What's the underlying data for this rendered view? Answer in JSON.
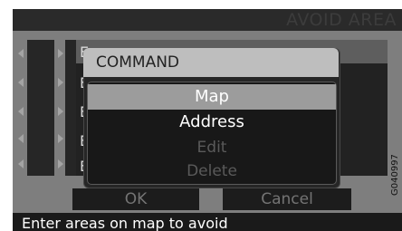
{
  "header": {
    "title": "AVOID AREA"
  },
  "list": {
    "row_initial": "E"
  },
  "dialog": {
    "title": "COMMAND",
    "menu": [
      {
        "label": "Map",
        "state": "selected"
      },
      {
        "label": "Address",
        "state": "enabled"
      },
      {
        "label": "Edit",
        "state": "disabled"
      },
      {
        "label": "Delete",
        "state": "disabled"
      }
    ]
  },
  "buttons": {
    "ok_label": "OK",
    "cancel_label": "Cancel"
  },
  "status": {
    "text": "Enter areas on map to avoid"
  },
  "figure_code": "G040997",
  "colors": {
    "selected": "#9c9c9c",
    "disabled_text": "#5a5a5a",
    "status_bg": "#1a1a1a"
  }
}
